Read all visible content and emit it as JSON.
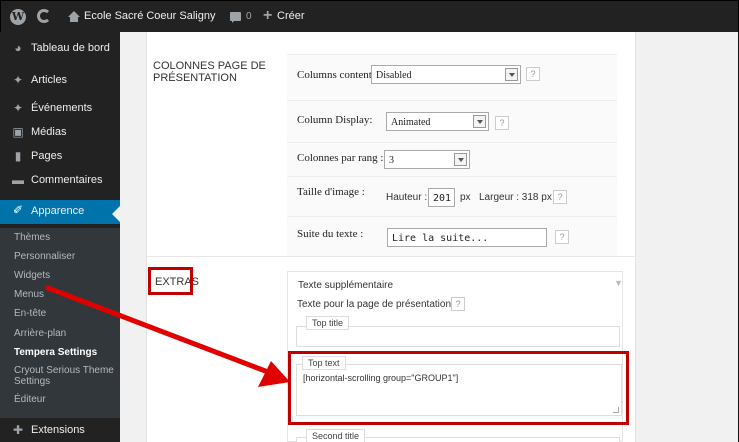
{
  "admin_bar": {
    "site_name": "Ecole Sacré Coeur Saligny",
    "comments_count": "0",
    "new_label": "Créer"
  },
  "sidebar": {
    "items": [
      {
        "label": "Tableau de bord",
        "icon": "dashboard-icon"
      },
      {
        "label": "Articles",
        "icon": "pin-icon"
      },
      {
        "label": "Événements",
        "icon": "pin-icon"
      },
      {
        "label": "Médias",
        "icon": "media-icon"
      },
      {
        "label": "Pages",
        "icon": "page-icon"
      },
      {
        "label": "Commentaires",
        "icon": "comment-icon"
      },
      {
        "label": "Apparence",
        "icon": "brush-icon"
      },
      {
        "label": "Extensions",
        "icon": "plugin-icon"
      }
    ],
    "submenu": [
      "Thèmes",
      "Personnaliser",
      "Widgets",
      "Menus",
      "En-tête",
      "Arrière-plan",
      "Tempera Settings",
      "Cryout Serious Theme",
      "Settings",
      "Éditeur"
    ]
  },
  "settings": {
    "presentation_section": "COLONNES PAGE DE",
    "presentation_section_2": "PRÉSENTATION",
    "columns_content_label": "Columns content:",
    "columns_content_value": "Disabled",
    "column_display_label": "Column Display:",
    "column_display_value": "Animated",
    "per_row_label": "Colonnes par rang :",
    "per_row_value": "3",
    "image_size_label": "Taille d'image :",
    "height_label": "Hauteur :",
    "height_value": "201",
    "height_unit": "px",
    "width_text": "Largeur : 318 px",
    "read_more_label": "Suite du texte :",
    "read_more_value": "Lire la suite...",
    "help": "?"
  },
  "extras": {
    "section": "EXTRAS",
    "extra_text_title": "Texte supplémentaire",
    "presentation_text_label": "Texte pour la page de présentation",
    "top_title_legend": "Top title",
    "top_text_legend": "Top text",
    "top_text_value": "[horizontal-scrolling group=\"GROUP1\"]",
    "second_title_legend": "Second title"
  },
  "annotation": {
    "highlight_color": "#c00000"
  }
}
